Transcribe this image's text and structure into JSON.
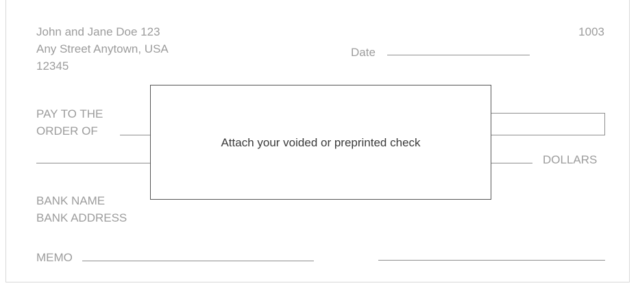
{
  "payer": {
    "name_line": "John and Jane Doe  123",
    "street_line": "Any Street Anytown, USA",
    "zip_line": "12345"
  },
  "check_number": "1003",
  "date_label": "Date",
  "pay_to": {
    "line1": "PAY TO THE",
    "line2": "ORDER OF"
  },
  "dollars_label": "DOLLARS",
  "bank": {
    "name": "BANK NAME",
    "address": "BANK ADDRESS"
  },
  "memo_label": "MEMO",
  "attach": {
    "text": "Attach your voided or preprinted check"
  }
}
